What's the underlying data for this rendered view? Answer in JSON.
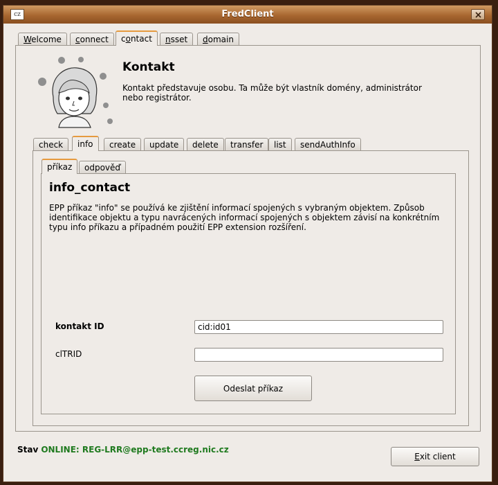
{
  "window": {
    "title": "FredClient",
    "icon_text": "cz"
  },
  "main_tabs": [
    {
      "label": "Welcome",
      "key": "W",
      "rest": "elcome"
    },
    {
      "label": "connect",
      "key": "c",
      "rest": "onnect"
    },
    {
      "label": "contact",
      "pre": "c",
      "key": "o",
      "rest": "ntact"
    },
    {
      "label": "nsset",
      "key": "n",
      "rest": "sset"
    },
    {
      "label": "domain",
      "key": "d",
      "rest": "omain"
    }
  ],
  "contact": {
    "heading": "Kontakt",
    "description": " Kontakt představuje osobu. Ta může být vlastník domény, administrátor nebo registrátor."
  },
  "sub_tabs": [
    "check",
    "info",
    "create",
    "update",
    "delete",
    "transfer",
    "list",
    "sendAuthInfo"
  ],
  "inner_tabs": [
    "příkaz",
    "odpověď"
  ],
  "info": {
    "heading": "info_contact",
    "description": " EPP příkaz \"info\" se používá ke zjištění informací spojených s vybraným objektem. Způsob identifikace objektu a typu navrácených informací spojených s objektem závisí na konkrétním typu info příkazu a případném použití EPP extension rozšíření."
  },
  "form": {
    "contact_id_label": "kontakt ID",
    "contact_id_value": "cid:id01",
    "cltrid_label": "clTRID",
    "cltrid_value": "",
    "submit_label": "Odeslat příkaz"
  },
  "status": {
    "label": "Stav",
    "value": "ONLINE: REG-LRR@epp-test.ccreg.nic.cz"
  },
  "exit": {
    "label": "Exit client",
    "key": "E",
    "rest": "xit client"
  },
  "colors": {
    "status_online": "#1f7a1f",
    "active_tab_accent": "#e69a3e",
    "titlebar": "#a86730"
  }
}
